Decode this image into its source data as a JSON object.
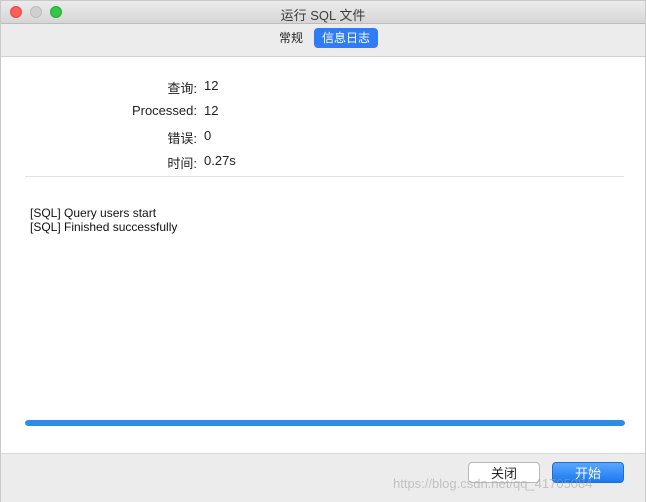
{
  "window": {
    "title": "运行 SQL 文件"
  },
  "tabs": [
    {
      "label": "常规",
      "active": false
    },
    {
      "label": "信息日志",
      "active": true
    }
  ],
  "stats": [
    {
      "label": "查询:",
      "value": "12"
    },
    {
      "label": "Processed:",
      "value": "12"
    },
    {
      "label": "错误:",
      "value": "0"
    },
    {
      "label": "时间:",
      "value": "0.27s"
    }
  ],
  "log": {
    "lines": [
      "[SQL] Query users start",
      "[SQL] Finished successfully"
    ]
  },
  "progress": {
    "fraction": 1.0,
    "color": "#2d8de6"
  },
  "buttons": {
    "close_label": "关闭",
    "start_label": "开始"
  },
  "watermark": "https://blog.csdn.net/qq_41705084",
  "colors": {
    "accent": "#2f7cf6",
    "close_light": "#fc5f57",
    "maximize_light": "#34c84a"
  },
  "icons": [
    "close-window-icon",
    "minimize-window-icon",
    "maximize-window-icon"
  ]
}
